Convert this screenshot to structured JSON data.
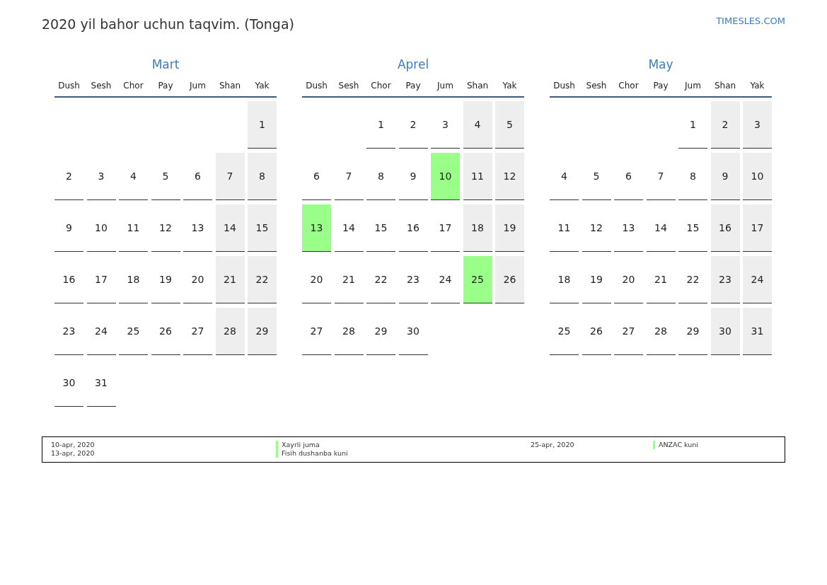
{
  "title": "2020 yil bahor uchun taqvim. (Tonga)",
  "site": "TIMESLES.COM",
  "months": [
    {
      "name": "Mart",
      "weekdays": [
        "Dush",
        "Sesh",
        "Chor",
        "Pay",
        "Jum",
        "Shan",
        "Yak"
      ],
      "weeks": [
        [
          {
            "kind": "blank"
          },
          {
            "kind": "blank"
          },
          {
            "kind": "blank"
          },
          {
            "kind": "blank"
          },
          {
            "kind": "blank"
          },
          {
            "kind": "blank"
          },
          {
            "kind": "day",
            "day": "1",
            "weekend": true,
            "holiday": false
          }
        ],
        [
          {
            "kind": "day",
            "day": "2",
            "weekend": false,
            "holiday": false
          },
          {
            "kind": "day",
            "day": "3",
            "weekend": false,
            "holiday": false
          },
          {
            "kind": "day",
            "day": "4",
            "weekend": false,
            "holiday": false
          },
          {
            "kind": "day",
            "day": "5",
            "weekend": false,
            "holiday": false
          },
          {
            "kind": "day",
            "day": "6",
            "weekend": false,
            "holiday": false
          },
          {
            "kind": "day",
            "day": "7",
            "weekend": true,
            "holiday": false
          },
          {
            "kind": "day",
            "day": "8",
            "weekend": true,
            "holiday": false
          }
        ],
        [
          {
            "kind": "day",
            "day": "9",
            "weekend": false,
            "holiday": false
          },
          {
            "kind": "day",
            "day": "10",
            "weekend": false,
            "holiday": false
          },
          {
            "kind": "day",
            "day": "11",
            "weekend": false,
            "holiday": false
          },
          {
            "kind": "day",
            "day": "12",
            "weekend": false,
            "holiday": false
          },
          {
            "kind": "day",
            "day": "13",
            "weekend": false,
            "holiday": false
          },
          {
            "kind": "day",
            "day": "14",
            "weekend": true,
            "holiday": false
          },
          {
            "kind": "day",
            "day": "15",
            "weekend": true,
            "holiday": false
          }
        ],
        [
          {
            "kind": "day",
            "day": "16",
            "weekend": false,
            "holiday": false
          },
          {
            "kind": "day",
            "day": "17",
            "weekend": false,
            "holiday": false
          },
          {
            "kind": "day",
            "day": "18",
            "weekend": false,
            "holiday": false
          },
          {
            "kind": "day",
            "day": "19",
            "weekend": false,
            "holiday": false
          },
          {
            "kind": "day",
            "day": "20",
            "weekend": false,
            "holiday": false
          },
          {
            "kind": "day",
            "day": "21",
            "weekend": true,
            "holiday": false
          },
          {
            "kind": "day",
            "day": "22",
            "weekend": true,
            "holiday": false
          }
        ],
        [
          {
            "kind": "day",
            "day": "23",
            "weekend": false,
            "holiday": false
          },
          {
            "kind": "day",
            "day": "24",
            "weekend": false,
            "holiday": false
          },
          {
            "kind": "day",
            "day": "25",
            "weekend": false,
            "holiday": false
          },
          {
            "kind": "day",
            "day": "26",
            "weekend": false,
            "holiday": false
          },
          {
            "kind": "day",
            "day": "27",
            "weekend": false,
            "holiday": false
          },
          {
            "kind": "day",
            "day": "28",
            "weekend": true,
            "holiday": false
          },
          {
            "kind": "day",
            "day": "29",
            "weekend": true,
            "holiday": false
          }
        ],
        [
          {
            "kind": "day",
            "day": "30",
            "weekend": false,
            "holiday": false
          },
          {
            "kind": "day",
            "day": "31",
            "weekend": false,
            "holiday": false
          },
          {
            "kind": "blank"
          },
          {
            "kind": "blank"
          },
          {
            "kind": "blank"
          },
          {
            "kind": "blank"
          },
          {
            "kind": "blank"
          }
        ]
      ]
    },
    {
      "name": "Aprel",
      "weekdays": [
        "Dush",
        "Sesh",
        "Chor",
        "Pay",
        "Jum",
        "Shan",
        "Yak"
      ],
      "weeks": [
        [
          {
            "kind": "blank"
          },
          {
            "kind": "blank"
          },
          {
            "kind": "day",
            "day": "1",
            "weekend": false,
            "holiday": false
          },
          {
            "kind": "day",
            "day": "2",
            "weekend": false,
            "holiday": false
          },
          {
            "kind": "day",
            "day": "3",
            "weekend": false,
            "holiday": false
          },
          {
            "kind": "day",
            "day": "4",
            "weekend": true,
            "holiday": false
          },
          {
            "kind": "day",
            "day": "5",
            "weekend": true,
            "holiday": false
          }
        ],
        [
          {
            "kind": "day",
            "day": "6",
            "weekend": false,
            "holiday": false
          },
          {
            "kind": "day",
            "day": "7",
            "weekend": false,
            "holiday": false
          },
          {
            "kind": "day",
            "day": "8",
            "weekend": false,
            "holiday": false
          },
          {
            "kind": "day",
            "day": "9",
            "weekend": false,
            "holiday": false
          },
          {
            "kind": "day",
            "day": "10",
            "weekend": false,
            "holiday": true
          },
          {
            "kind": "day",
            "day": "11",
            "weekend": true,
            "holiday": false
          },
          {
            "kind": "day",
            "day": "12",
            "weekend": true,
            "holiday": false
          }
        ],
        [
          {
            "kind": "day",
            "day": "13",
            "weekend": false,
            "holiday": true
          },
          {
            "kind": "day",
            "day": "14",
            "weekend": false,
            "holiday": false
          },
          {
            "kind": "day",
            "day": "15",
            "weekend": false,
            "holiday": false
          },
          {
            "kind": "day",
            "day": "16",
            "weekend": false,
            "holiday": false
          },
          {
            "kind": "day",
            "day": "17",
            "weekend": false,
            "holiday": false
          },
          {
            "kind": "day",
            "day": "18",
            "weekend": true,
            "holiday": false
          },
          {
            "kind": "day",
            "day": "19",
            "weekend": true,
            "holiday": false
          }
        ],
        [
          {
            "kind": "day",
            "day": "20",
            "weekend": false,
            "holiday": false
          },
          {
            "kind": "day",
            "day": "21",
            "weekend": false,
            "holiday": false
          },
          {
            "kind": "day",
            "day": "22",
            "weekend": false,
            "holiday": false
          },
          {
            "kind": "day",
            "day": "23",
            "weekend": false,
            "holiday": false
          },
          {
            "kind": "day",
            "day": "24",
            "weekend": false,
            "holiday": false
          },
          {
            "kind": "day",
            "day": "25",
            "weekend": true,
            "holiday": true
          },
          {
            "kind": "day",
            "day": "26",
            "weekend": true,
            "holiday": false
          }
        ],
        [
          {
            "kind": "day",
            "day": "27",
            "weekend": false,
            "holiday": false
          },
          {
            "kind": "day",
            "day": "28",
            "weekend": false,
            "holiday": false
          },
          {
            "kind": "day",
            "day": "29",
            "weekend": false,
            "holiday": false
          },
          {
            "kind": "day",
            "day": "30",
            "weekend": false,
            "holiday": false
          },
          {
            "kind": "blank"
          },
          {
            "kind": "blank"
          },
          {
            "kind": "blank"
          }
        ]
      ]
    },
    {
      "name": "May",
      "weekdays": [
        "Dush",
        "Sesh",
        "Chor",
        "Pay",
        "Jum",
        "Shan",
        "Yak"
      ],
      "weeks": [
        [
          {
            "kind": "blank"
          },
          {
            "kind": "blank"
          },
          {
            "kind": "blank"
          },
          {
            "kind": "blank"
          },
          {
            "kind": "day",
            "day": "1",
            "weekend": false,
            "holiday": false
          },
          {
            "kind": "day",
            "day": "2",
            "weekend": true,
            "holiday": false
          },
          {
            "kind": "day",
            "day": "3",
            "weekend": true,
            "holiday": false
          }
        ],
        [
          {
            "kind": "day",
            "day": "4",
            "weekend": false,
            "holiday": false
          },
          {
            "kind": "day",
            "day": "5",
            "weekend": false,
            "holiday": false
          },
          {
            "kind": "day",
            "day": "6",
            "weekend": false,
            "holiday": false
          },
          {
            "kind": "day",
            "day": "7",
            "weekend": false,
            "holiday": false
          },
          {
            "kind": "day",
            "day": "8",
            "weekend": false,
            "holiday": false
          },
          {
            "kind": "day",
            "day": "9",
            "weekend": true,
            "holiday": false
          },
          {
            "kind": "day",
            "day": "10",
            "weekend": true,
            "holiday": false
          }
        ],
        [
          {
            "kind": "day",
            "day": "11",
            "weekend": false,
            "holiday": false
          },
          {
            "kind": "day",
            "day": "12",
            "weekend": false,
            "holiday": false
          },
          {
            "kind": "day",
            "day": "13",
            "weekend": false,
            "holiday": false
          },
          {
            "kind": "day",
            "day": "14",
            "weekend": false,
            "holiday": false
          },
          {
            "kind": "day",
            "day": "15",
            "weekend": false,
            "holiday": false
          },
          {
            "kind": "day",
            "day": "16",
            "weekend": true,
            "holiday": false
          },
          {
            "kind": "day",
            "day": "17",
            "weekend": true,
            "holiday": false
          }
        ],
        [
          {
            "kind": "day",
            "day": "18",
            "weekend": false,
            "holiday": false
          },
          {
            "kind": "day",
            "day": "19",
            "weekend": false,
            "holiday": false
          },
          {
            "kind": "day",
            "day": "20",
            "weekend": false,
            "holiday": false
          },
          {
            "kind": "day",
            "day": "21",
            "weekend": false,
            "holiday": false
          },
          {
            "kind": "day",
            "day": "22",
            "weekend": false,
            "holiday": false
          },
          {
            "kind": "day",
            "day": "23",
            "weekend": true,
            "holiday": false
          },
          {
            "kind": "day",
            "day": "24",
            "weekend": true,
            "holiday": false
          }
        ],
        [
          {
            "kind": "day",
            "day": "25",
            "weekend": false,
            "holiday": false
          },
          {
            "kind": "day",
            "day": "26",
            "weekend": false,
            "holiday": false
          },
          {
            "kind": "day",
            "day": "27",
            "weekend": false,
            "holiday": false
          },
          {
            "kind": "day",
            "day": "28",
            "weekend": false,
            "holiday": false
          },
          {
            "kind": "day",
            "day": "29",
            "weekend": false,
            "holiday": false
          },
          {
            "kind": "day",
            "day": "30",
            "weekend": true,
            "holiday": false
          },
          {
            "kind": "day",
            "day": "31",
            "weekend": true,
            "holiday": false
          }
        ]
      ]
    }
  ],
  "legend": [
    {
      "dates": [
        "10-apr, 2020",
        "13-apr, 2020"
      ],
      "names": [
        "Xayrli juma",
        "Fisih dushanba kuni"
      ]
    },
    {
      "dates": [
        "25-apr, 2020"
      ],
      "names": [
        "ANZAC kuni"
      ]
    }
  ]
}
